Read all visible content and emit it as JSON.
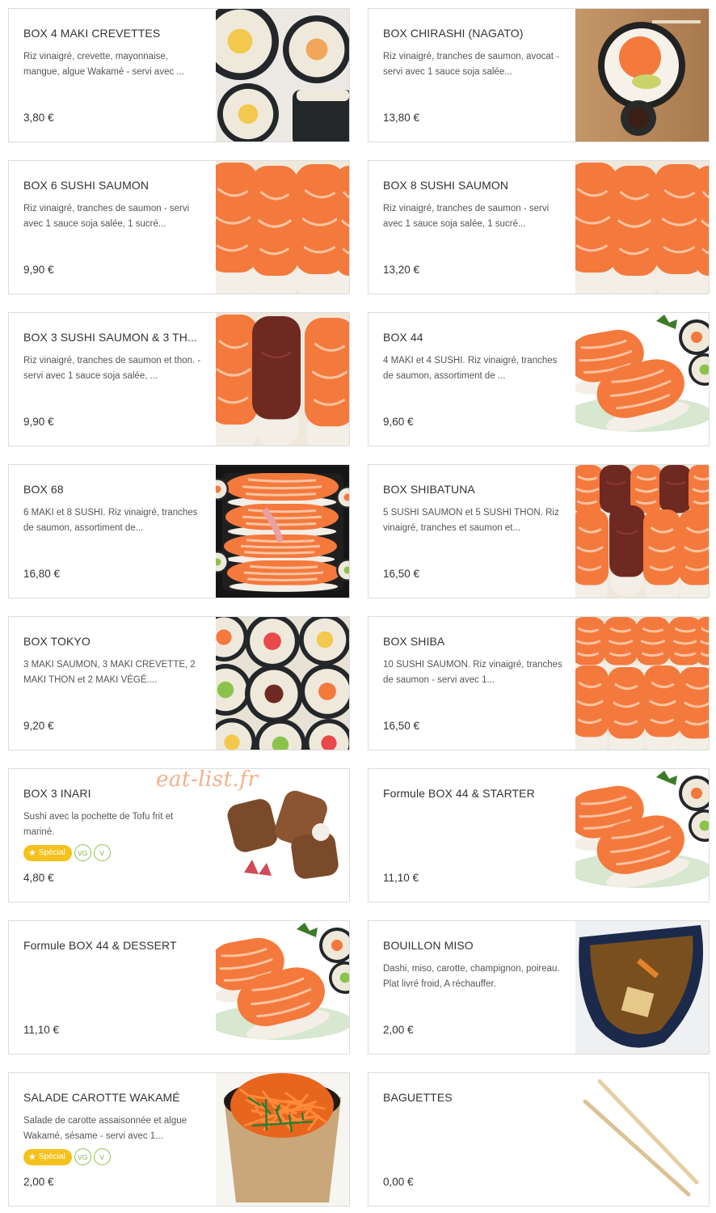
{
  "watermark": "eat-list.fr",
  "badge_labels": {
    "special": "Spécial",
    "vg": "VG",
    "v": "V"
  },
  "items": [
    {
      "title": "BOX 4 MAKI CREVETTES",
      "desc": "Riz vinaigré, crevette, mayonnaise, mangue, algue Wakamé - servi avec ...",
      "price": "3,80 €",
      "image": "maki-shrimp-photo"
    },
    {
      "title": "BOX CHIRASHI (NAGATO)",
      "desc": "Riz vinaigré, tranches de saumon, avocat - servi avec 1 sauce soja salée...",
      "price": "13,80 €",
      "image": "chirashi-bowl-photo"
    },
    {
      "title": "BOX 6 SUSHI SAUMON",
      "desc": "Riz vinaigré, tranches de saumon - servi avec 1 sauce soja salée, 1 sucré...",
      "price": "9,90 €",
      "image": "salmon-sushi-photo"
    },
    {
      "title": "BOX 8 SUSHI SAUMON",
      "desc": "Riz vinaigré, tranches de saumon - servi avec 1 sauce soja salée, 1 sucré...",
      "price": "13,20 €",
      "image": "salmon-sushi-photo"
    },
    {
      "title": "BOX 3 SUSHI SAUMON & 3 TH...",
      "desc": "Riz vinaigré, tranches de saumon et thon. - servi avec 1 sauce soja salée, ...",
      "price": "9,90 €",
      "image": "salmon-tuna-sushi-photo"
    },
    {
      "title": "BOX 44",
      "desc": "4 MAKI et 4 SUSHI. Riz vinaigré, tranches de saumon, assortiment de ...",
      "price": "9,60 €",
      "image": "sushi-maki-plate-photo"
    },
    {
      "title": "BOX 68",
      "desc": "6 MAKI et 8 SUSHI. Riz vinaigré, tranches de saumon, assortiment de...",
      "price": "16,80 €",
      "image": "sushi-box-photo"
    },
    {
      "title": "BOX SHIBATUNA",
      "desc": "5 SUSHI SAUMON et 5 SUSHI THON. Riz vinaigré, tranches et saumon et...",
      "price": "16,50 €",
      "image": "salmon-tuna-rows-photo"
    },
    {
      "title": "BOX TOKYO",
      "desc": "3 MAKI SAUMON, 3 MAKI CREVETTE, 2 MAKI THON et 2 MAKI VÉGÉ....",
      "price": "9,20 €",
      "image": "maki-assortment-photo"
    },
    {
      "title": "BOX SHIBA",
      "desc": "10 SUSHI SAUMON. Riz vinaigré, tranches de saumon - servi avec 1...",
      "price": "16,50 €",
      "image": "salmon-sushi-rows-photo"
    },
    {
      "title": "BOX 3 INARI",
      "desc": "Sushi avec la pochette de Tofu frit et mariné.",
      "price": "4,80 €",
      "image": "inari-photo",
      "badges": true
    },
    {
      "title": "Formule BOX 44 & STARTER",
      "desc": "",
      "price": "11,10 €",
      "image": "sushi-maki-plate-photo"
    },
    {
      "title": "Formule BOX 44 & DESSERT",
      "desc": "",
      "price": "11,10 €",
      "image": "sushi-maki-plate-photo"
    },
    {
      "title": "BOUILLON MISO",
      "desc": "Dashi, miso, carotte, champignon, poireau. Plat livré froid, A réchauffer.",
      "price": "2,00 €",
      "image": "miso-soup-photo"
    },
    {
      "title": "SALADE CAROTTE WAKAMÉ",
      "desc": "Salade de carotte assaisonnée et algue Wakamé, sésame - servi avec 1...",
      "price": "2,00 €",
      "image": "carrot-salad-photo",
      "badges": true
    },
    {
      "title": "BAGUETTES",
      "desc": "",
      "price": "0,00 €",
      "image": "chopsticks-photo"
    }
  ],
  "colors": {
    "border": "#dcdcdc",
    "badge_special": "#f5c11b",
    "badge_veg": "#8bc34a",
    "salmon": "#f4793d",
    "nori": "#23272a"
  }
}
